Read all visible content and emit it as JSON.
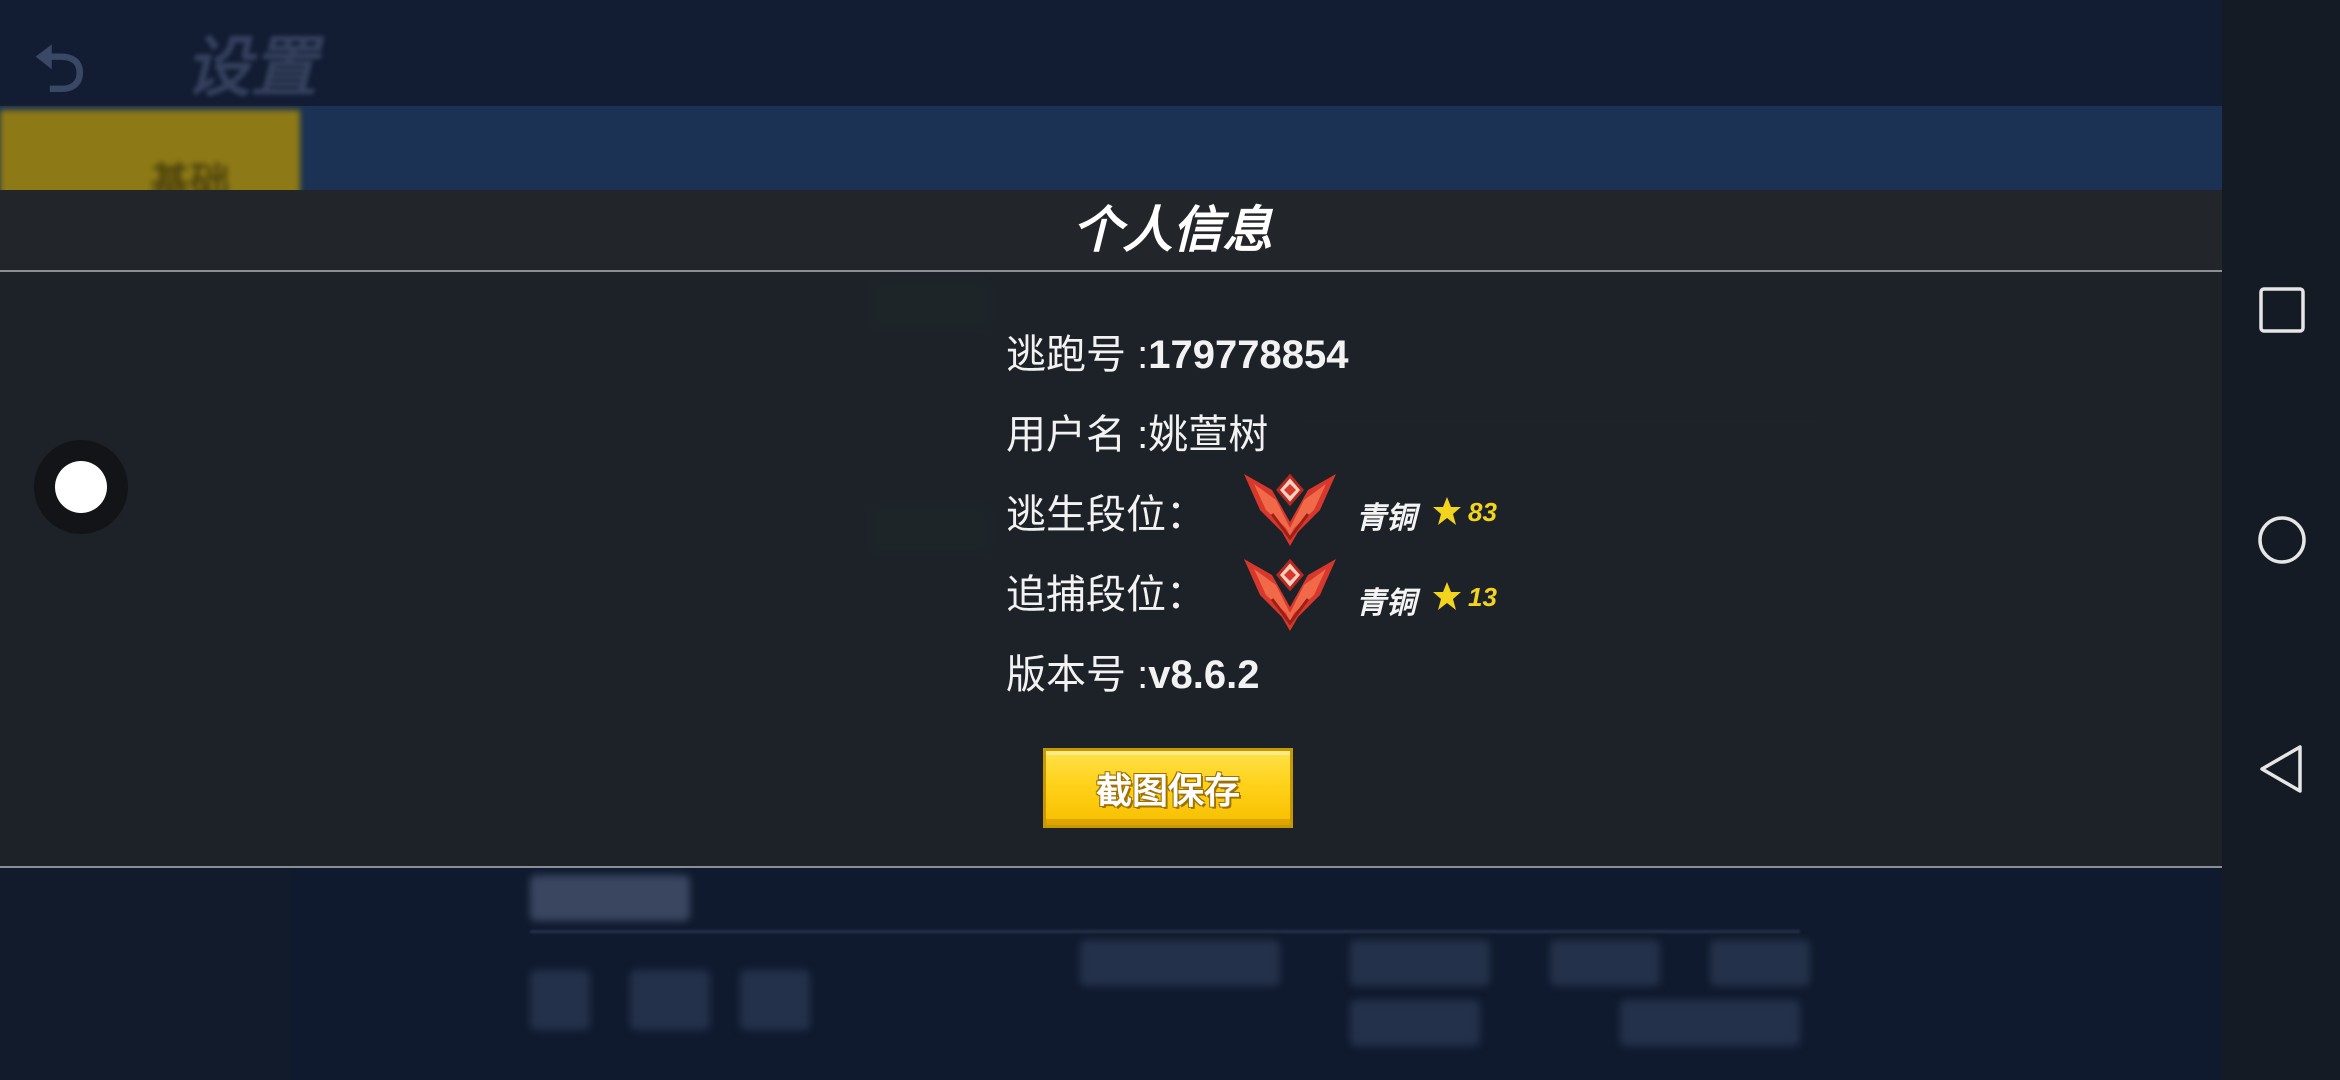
{
  "background": {
    "back_glyph": "⮌",
    "title": "设置",
    "active_tab": "基础"
  },
  "modal": {
    "title": "个人信息",
    "rows": {
      "escape_id": {
        "label": "逃跑号 :",
        "value": "179778854"
      },
      "username": {
        "label": "用户名 :",
        "value": "姚萱树"
      },
      "escape_rank": {
        "label": "逃生段位：",
        "rank": "青铜",
        "stars": "83"
      },
      "chase_rank": {
        "label": "追捕段位：",
        "rank": "青铜",
        "stars": "13"
      },
      "version": {
        "label": "版本号 :",
        "value": "v8.6.2"
      }
    },
    "save_button": "截图保存"
  },
  "icons": {
    "close": "close-icon",
    "rank_badge": "bronze-rank-badge-icon",
    "star": "star-icon",
    "nav_recent": "square-icon",
    "nav_home": "circle-icon",
    "nav_back": "triangle-back-icon"
  },
  "colors": {
    "accent_yellow": "#ffd21a",
    "star_yellow": "#f2d31e",
    "badge_red": "#d8382c",
    "modal_bg": "#1e2228",
    "navbar_bg": "#151b24"
  }
}
